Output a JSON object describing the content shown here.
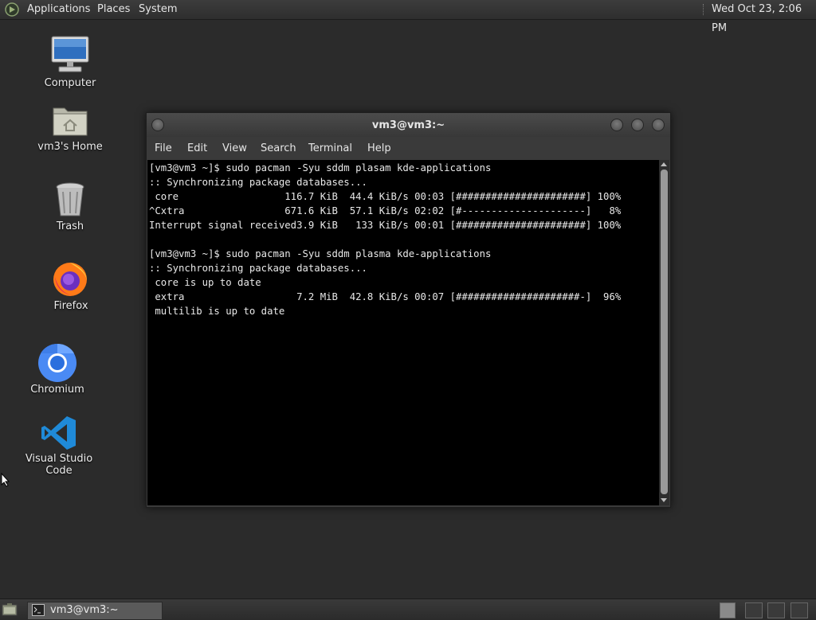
{
  "top_panel": {
    "menus": [
      "Applications",
      "Places",
      "System"
    ],
    "clock": "Wed Oct 23,  2:06 PM"
  },
  "desktop_icons": [
    {
      "label": "Computer",
      "icon": "computer-icon"
    },
    {
      "label": "vm3's Home",
      "icon": "home-folder-icon"
    },
    {
      "label": "Trash",
      "icon": "trash-icon"
    },
    {
      "label": "Firefox",
      "icon": "firefox-icon"
    },
    {
      "label": "Chromium",
      "icon": "chromium-icon"
    },
    {
      "label": "Visual Studio Code",
      "icon": "vscode-icon"
    }
  ],
  "terminal": {
    "title": "vm3@vm3:~",
    "menu": [
      "File",
      "Edit",
      "View",
      "Search",
      "Terminal",
      "Help"
    ],
    "lines": [
      "[vm3@vm3 ~]$ sudo pacman -Syu sddm plasam kde-applications",
      ":: Synchronizing package databases...",
      " core                  116.7 KiB  44.4 KiB/s 00:03 [######################] 100%",
      "^Cxtra                 671.6 KiB  57.1 KiB/s 02:02 [#---------------------]   8%",
      "Interrupt signal received3.9 KiB   133 KiB/s 00:01 [######################] 100%",
      "",
      "[vm3@vm3 ~]$ sudo pacman -Syu sddm plasma kde-applications",
      ":: Synchronizing package databases...",
      " core is up to date",
      " extra                   7.2 MiB  42.8 KiB/s 00:07 [#####################-]  96%",
      " multilib is up to date"
    ]
  },
  "taskbar": {
    "window_button": "vm3@vm3:~"
  },
  "colors": {
    "desktop_bg": "#2b2b2b",
    "terminal_bg": "#000000",
    "terminal_fg": "#e8e8e8"
  }
}
